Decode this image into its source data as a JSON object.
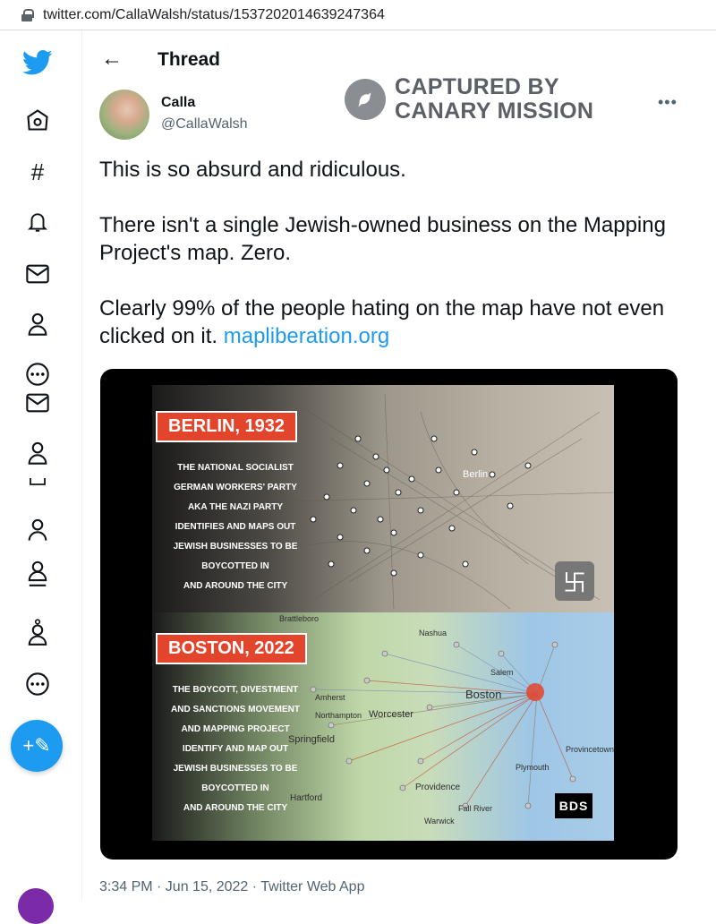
{
  "browser": {
    "url": "twitter.com/CallaWalsh/status/1537202014639247364"
  },
  "sidebar": {
    "icons": [
      "twitter-logo-icon",
      "home-icon",
      "explore-icon",
      "notifications-icon",
      "messages-icon",
      "profile-icon",
      "more-circle-icon",
      "messages-icon",
      "profile-icon",
      "profile-icon",
      "profile-icon",
      "profile-icon",
      "more-circle-icon"
    ],
    "compose_glyph": "+✎"
  },
  "header": {
    "back_glyph": "←",
    "title": "Thread"
  },
  "tweet": {
    "author_name": "Calla",
    "author_handle": "@CallaWalsh",
    "more_glyph": "•••",
    "watermark_line1": "CAPTURED BY",
    "watermark_line2": "CANARY MISSION",
    "paragraph1": "This is so absurd and ridiculous.",
    "paragraph2": "There isn't a single Jewish-owned business on the Mapping Project's map. Zero.",
    "paragraph3_text": "Clearly 99% of the people hating on the map have not even clicked on it. ",
    "paragraph3_link": "mapliberation.org",
    "timestamp": "3:34 PM · Jun 15, 2022 · Twitter Web App"
  },
  "media": {
    "top_banner": "BERLIN, 1932",
    "top_caption": [
      "THE NATIONAL SOCIALIST",
      "GERMAN WORKERS' PARTY",
      "AKA THE NAZI PARTY",
      "IDENTIFIES AND MAPS OUT",
      "JEWISH BUSINESSES TO BE",
      "BOYCOTTED IN",
      "AND AROUND THE CITY"
    ],
    "bottom_banner": "BOSTON, 2022",
    "bottom_caption": [
      "THE BOYCOTT, DIVESTMENT",
      "AND SANCTIONS MOVEMENT",
      "AND MAPPING PROJECT",
      "IDENTIFY AND MAP OUT",
      "JEWISH BUSINESSES TO BE",
      "BOYCOTTED IN",
      "AND AROUND THE CITY"
    ],
    "top_map_label": "Berlin",
    "bottom_map_labels": [
      "Brattleboro",
      "Nashua",
      "Salem",
      "Boston",
      "Amherst",
      "Northampton",
      "Worcester",
      "Springfield",
      "Provincetown",
      "Plymouth",
      "Providence",
      "Hartford",
      "Fall River",
      "Warwick"
    ],
    "swastika_glyph": "卐",
    "bds_label": "BDS"
  }
}
